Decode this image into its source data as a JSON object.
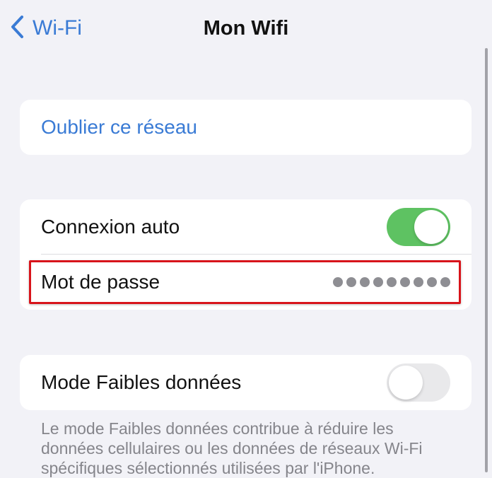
{
  "nav": {
    "back_label": "Wi-Fi",
    "title": "Mon Wifi"
  },
  "groups": {
    "forget": {
      "label": "Oublier ce réseau"
    },
    "connection": {
      "auto_join_label": "Connexion auto",
      "auto_join_enabled": true,
      "password_label": "Mot de passe",
      "password_masked": "•••••••••",
      "password_dot_count": 9
    },
    "low_data": {
      "label": "Mode Faibles données",
      "enabled": false,
      "footnote": "Le mode Faibles données contribue à réduire les données cellulaires ou les données de réseaux Wi-Fi spécifiques sélectionnés utilisées par l'iPhone."
    }
  },
  "colors": {
    "accent": "#3a7bd5",
    "toggle_on": "#5ec262",
    "toggle_off": "#e9e9eb",
    "highlight": "#d8141b",
    "background": "#f2f2f7"
  }
}
